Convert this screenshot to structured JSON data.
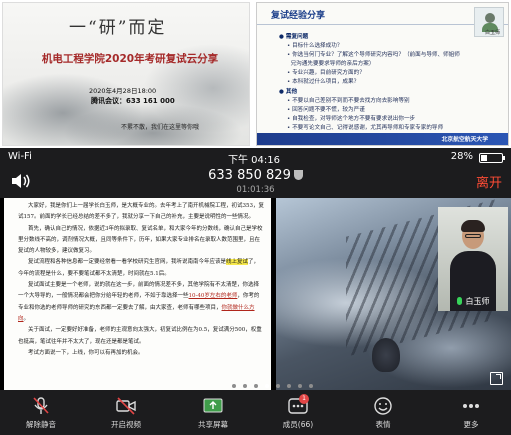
{
  "slide_left": {
    "title": "一“研”而定",
    "subtitle": "机电工程学院2020年考研复试云分享",
    "date": "2020年4月28日18:00",
    "meeting_id": "腾讯会议：633 161 000",
    "footer": "不累不散，我们在这里等你哦"
  },
  "slide_right": {
    "title": "复试经验分享",
    "avatar_name": "白玉师",
    "section1": "需复问题",
    "items1": [
      "目标什么选择成功？",
      "你选当何门专业？了解这个导师研究内容吗？（前面与导师、师姐师",
      "兄沟通先要要求导师的亲后方案）",
      "专业兴趣，目前研究方面的？",
      "本科就过什么项目，成果？"
    ],
    "section2": "其他",
    "items2": [
      "不要以自己差别不到而不要去找方向去影响等别",
      "回答问题不要不慌，较为严谨",
      "自我检查，对导师这个地方不要有要求说出你一步",
      "不要写论文自己、记得说感谢，尤其再导师和专家专家的导师"
    ],
    "footer": "北京航空航天大学"
  },
  "status": {
    "network": "Wi-Fi",
    "time": "下午 04:16",
    "battery_text": "28%",
    "battery_level": 0.28
  },
  "meeting": {
    "id": "633 850 829",
    "elapsed": "01:01:36",
    "leave_label": "离开"
  },
  "document": {
    "paragraphs": [
      "大家好，我是你们上一届学长白玉师，是大概专业的。去年考上了南开机械院工程，初试353，复试157。前面的学长已经总结的差不多了，我就分享一下自己的补充，主要是说明性的一些情况。",
      "首先，确认自己的情况，依据近3年的拟录取、复试名单，和大家今年的分数线，确认自己是学校里分数线不高的，调剂情况大概，且同等条件下，历年，如果大家专业排名在录取人数范围里，且在复试的人物较多，建议做复习。",
      "复试流程和各种信息都一定要经常看一看学校研究生官网，我听说南南今年应该是线上复试了，今年的流程是什么，要不要笔试都不太清楚，时间就在5.1后。",
      "复试面试主要是一个老师，说的就在这一步，前面的情况差不多，其他学院有不太清楚，你选择一个大导导的，一般情况都会把你分给年轻的老师，不如于靠选择一些10-40岁左右的老师，你考的专业和你选的老师导师的研究的东西都一定要去了解，由大家查，老师有哪些项目，你就做什么方向。",
      "关于面试，一定要好好准备，老师的主观意向太强大，初复试比例在为0.5，复试满分500，权重也挺高，笔试往年并不太大了，现在还是都是笔试。",
      "考试方面说一下，上线，你可以有再加的机会。"
    ]
  },
  "pip": {
    "name": "白玉师"
  },
  "pagination": {
    "count": 8,
    "active_index": 3
  },
  "toolbar": {
    "items": [
      {
        "label": "解除静音",
        "icon": "mic-muted-icon"
      },
      {
        "label": "开启视频",
        "icon": "video-off-icon"
      },
      {
        "label": "共享屏幕",
        "icon": "share-screen-icon"
      },
      {
        "label": "成员(66)",
        "icon": "members-icon",
        "badge": "1"
      },
      {
        "label": "表情",
        "icon": "emoji-icon"
      },
      {
        "label": "更多",
        "icon": "more-icon"
      }
    ]
  },
  "colors": {
    "leave": "#ff4c35",
    "slide_accent": "#1b3e8a",
    "highlight": "#f6e84a"
  }
}
